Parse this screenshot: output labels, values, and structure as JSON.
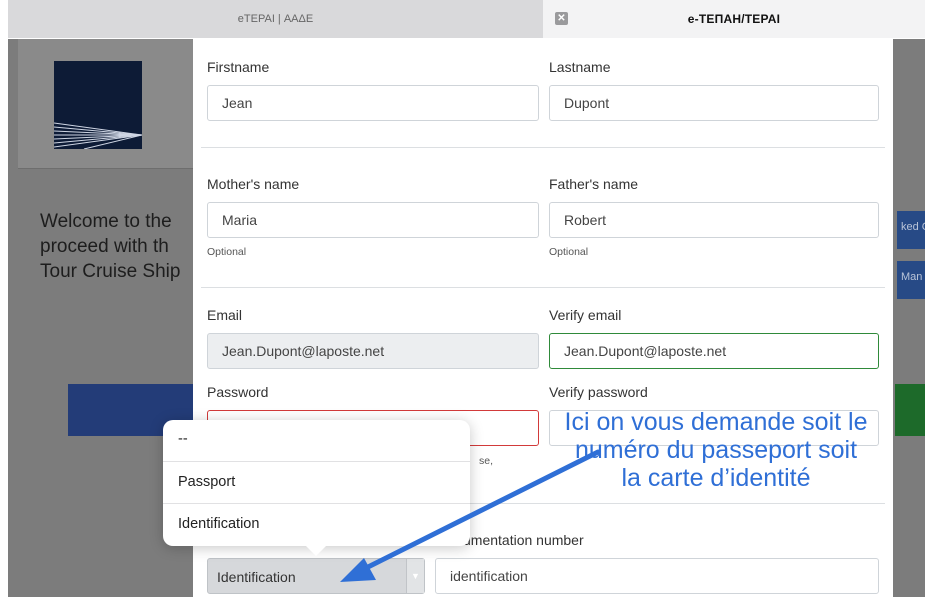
{
  "tabs": [
    {
      "label": "eTEPAI | ΑΑΔΕ"
    },
    {
      "label": "e-ΤΕΠΑΗ/TEPAI"
    }
  ],
  "background": {
    "welcome_text": "Welcome to the\nproceed with th\nTour Cruise Ship",
    "side_buttons": [
      "ked C",
      "Man"
    ]
  },
  "form": {
    "firstname": {
      "label": "Firstname",
      "value": "Jean"
    },
    "lastname": {
      "label": "Lastname",
      "value": "Dupont"
    },
    "mother": {
      "label": "Mother's name",
      "value": "Maria",
      "help": "Optional"
    },
    "father": {
      "label": "Father's name",
      "value": "Robert",
      "help": "Optional"
    },
    "email": {
      "label": "Email",
      "value": "Jean.Dupont@laposte.net"
    },
    "verify_email": {
      "label": "Verify email",
      "value": "Jean.Dupont@laposte.net"
    },
    "password": {
      "label": "Password",
      "value": "",
      "help_fragment": "se,"
    },
    "verify_password": {
      "label": "Verify password",
      "value": ""
    },
    "document_type": {
      "selected": "Identification"
    },
    "document_number": {
      "label_fragment": "umentation number",
      "value": "identification"
    }
  },
  "dropdown": {
    "options": [
      "--",
      "Passport",
      "Identification"
    ]
  },
  "annotation": {
    "text": "Ici on vous demande soit le numéro du passeport soit la carte d’identité",
    "color": "#2f6fd6"
  }
}
